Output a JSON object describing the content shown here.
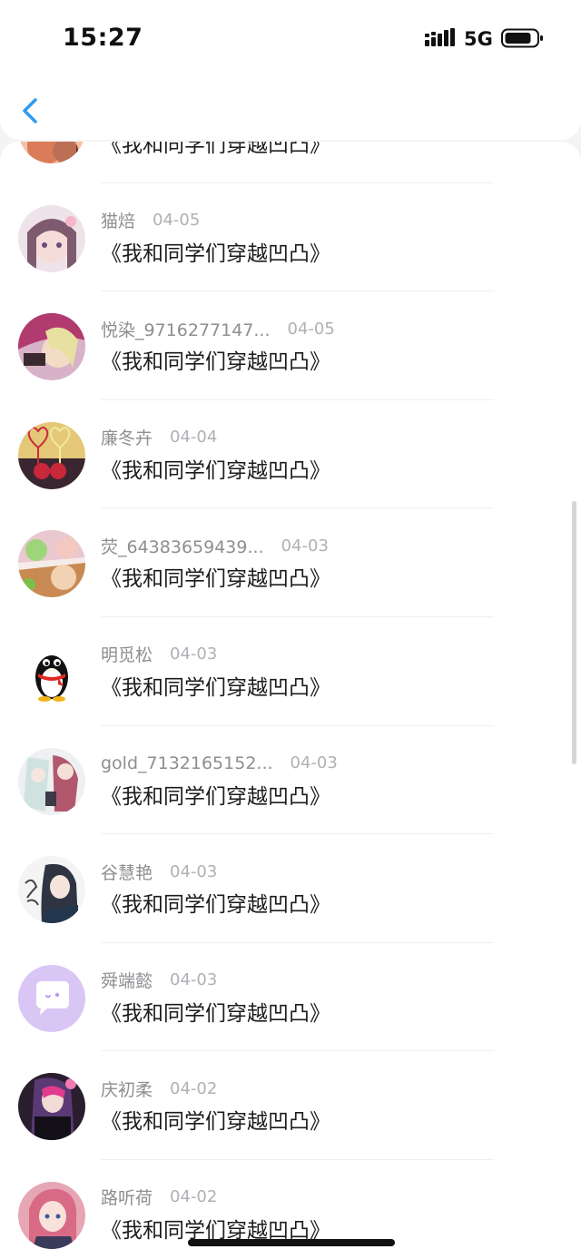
{
  "status_bar": {
    "time": "15:27",
    "network": "5G"
  },
  "colors": {
    "accent": "#2f9bf0",
    "secondary_text": "#8e8e93",
    "primary_text": "#1c1c1e"
  },
  "rows": [
    {
      "name": "",
      "date": "",
      "message": "《我和同学们穿越凹凸》"
    },
    {
      "name": "猫焙",
      "date": "04-05",
      "message": "《我和同学们穿越凹凸》"
    },
    {
      "name": "悦染_9716277147...",
      "date": "04-05",
      "message": "《我和同学们穿越凹凸》"
    },
    {
      "name": "廉冬卉",
      "date": "04-04",
      "message": "《我和同学们穿越凹凸》"
    },
    {
      "name": "荧_64383659439...",
      "date": "04-03",
      "message": "《我和同学们穿越凹凸》"
    },
    {
      "name": "明觅松",
      "date": "04-03",
      "message": "《我和同学们穿越凹凸》"
    },
    {
      "name": "gold_7132165152...",
      "date": "04-03",
      "message": "《我和同学们穿越凹凸》"
    },
    {
      "name": "谷慧艳",
      "date": "04-03",
      "message": "《我和同学们穿越凹凸》"
    },
    {
      "name": "舜端懿",
      "date": "04-03",
      "message": "《我和同学们穿越凹凸》"
    },
    {
      "name": "庆初柔",
      "date": "04-02",
      "message": "《我和同学们穿越凹凸》"
    },
    {
      "name": "路听荷",
      "date": "04-02",
      "message": "《我和同学们穿越凹凸》"
    }
  ]
}
